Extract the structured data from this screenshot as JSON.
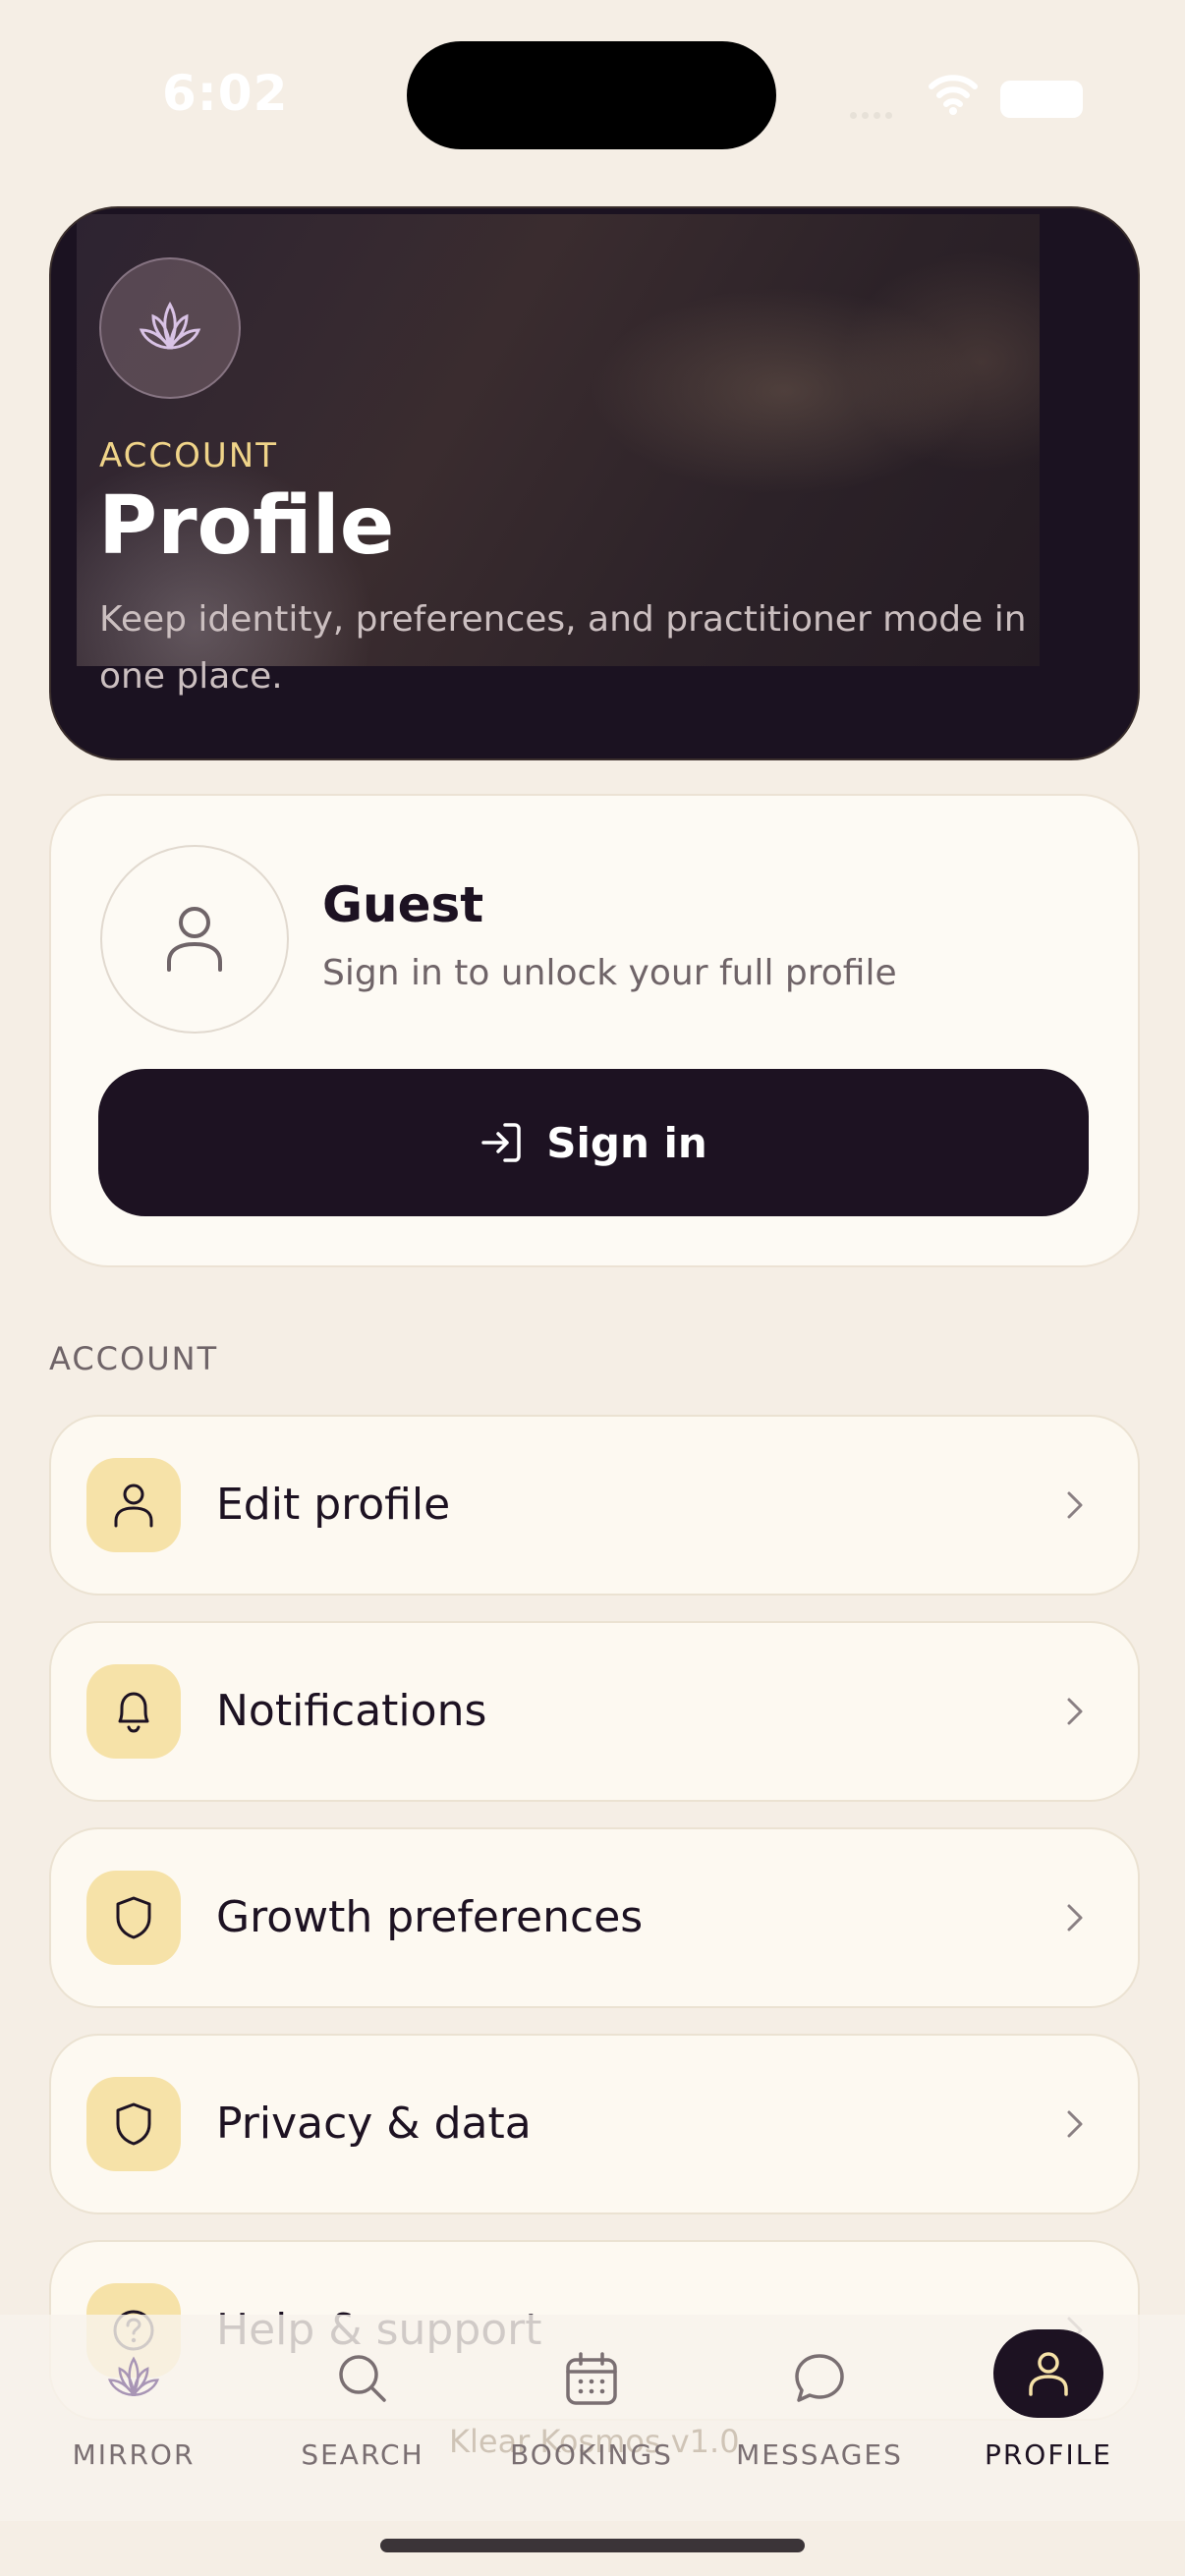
{
  "status_bar": {
    "time": "6:02"
  },
  "hero": {
    "eyebrow": "ACCOUNT",
    "title": "Profile",
    "subtitle": "Keep identity, preferences, and practitioner mode in one place."
  },
  "guest": {
    "name": "Guest",
    "subtitle": "Sign in to unlock your full profile",
    "sign_in_label": "Sign in"
  },
  "account_section": {
    "label": "ACCOUNT",
    "items": [
      {
        "label": "Edit profile",
        "icon": "person-icon"
      },
      {
        "label": "Notifications",
        "icon": "bell-icon"
      },
      {
        "label": "Growth preferences",
        "icon": "shield-icon"
      },
      {
        "label": "Privacy & data",
        "icon": "shield-icon"
      },
      {
        "label": "Help & support",
        "icon": "question-circle-icon"
      }
    ]
  },
  "footer": {
    "version": "Klear Kosmos v1.0"
  },
  "tabbar": {
    "tabs": [
      {
        "label": "MIRROR",
        "icon": "lotus-icon"
      },
      {
        "label": "SEARCH",
        "icon": "search-icon"
      },
      {
        "label": "BOOKINGS",
        "icon": "calendar-icon"
      },
      {
        "label": "MESSAGES",
        "icon": "chat-bubble-icon"
      },
      {
        "label": "PROFILE",
        "icon": "person-icon",
        "active": true
      }
    ]
  },
  "colors": {
    "background": "#f5eee5",
    "dark": "#1d1222",
    "accent_gold": "#f0d489",
    "icon_tile": "#f6e2a8",
    "card": "#fdf9f1"
  }
}
